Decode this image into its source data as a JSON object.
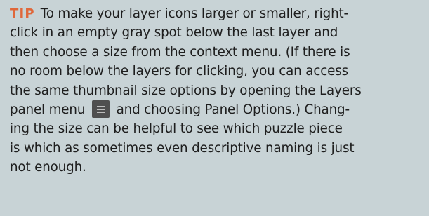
{
  "tip": {
    "label": "TIP",
    "lines": [
      "To make your layer icons larger or smaller, right-",
      "click in an empty gray spot below the last layer and",
      "then choose a size from the context menu. (If there is",
      "no room below the layers for clicking, you can access",
      "the same thumbnail size options by opening the Layers",
      "panel menu",
      "and choosing Panel Options.) Chang-",
      "ing the size can be helpful to see which puzzle piece",
      "is which as sometimes even descriptive naming is just",
      "not enough."
    ],
    "icon": "panel-menu-icon",
    "colors": {
      "background": "#c8d3d6",
      "label": "#e0673a",
      "text": "#1e1e1e",
      "icon_background": "#4f4f4f"
    }
  }
}
